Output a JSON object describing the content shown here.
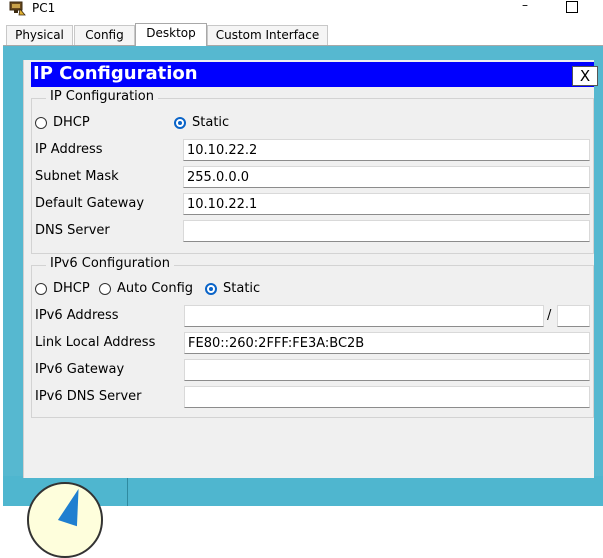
{
  "window": {
    "title": "PC1"
  },
  "tabs": [
    {
      "label": "Physical"
    },
    {
      "label": "Config"
    },
    {
      "label": "Desktop"
    },
    {
      "label": "Custom Interface"
    }
  ],
  "active_tab": "Desktop",
  "dialog": {
    "title": "IP Configuration",
    "close_label": "X",
    "ipv4": {
      "legend": "IP Configuration",
      "mode_options": [
        {
          "label": "DHCP",
          "checked": false
        },
        {
          "label": "Static",
          "checked": true
        }
      ],
      "fields": [
        {
          "label": "IP Address",
          "value": "10.10.22.2"
        },
        {
          "label": "Subnet Mask",
          "value": "255.0.0.0"
        },
        {
          "label": "Default Gateway",
          "value": "10.10.22.1"
        },
        {
          "label": "DNS Server",
          "value": ""
        }
      ]
    },
    "ipv6": {
      "legend": "IPv6 Configuration",
      "mode_options": [
        {
          "label": "DHCP",
          "checked": false
        },
        {
          "label": "Auto Config",
          "checked": false
        },
        {
          "label": "Static",
          "checked": true
        }
      ],
      "address_label": "IPv6 Address",
      "address_value": "",
      "prefix_separator": "/",
      "prefix_value": "",
      "fields": [
        {
          "label": "Link Local Address",
          "value": "FE80::260:2FFF:FE3A:BC2B"
        },
        {
          "label": "IPv6 Gateway",
          "value": ""
        },
        {
          "label": "IPv6 DNS Server",
          "value": ""
        }
      ]
    }
  },
  "colors": {
    "dialog_title_bg": "#0000ff",
    "desktop_bg": "#56b8d0",
    "radio_accent": "#0a64c8"
  }
}
